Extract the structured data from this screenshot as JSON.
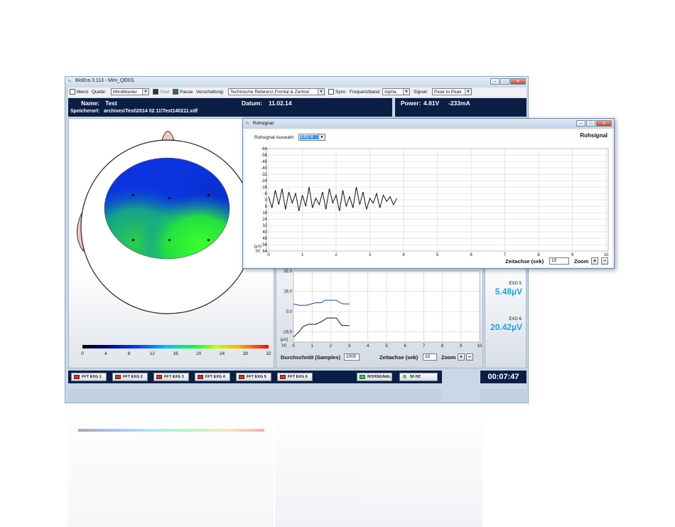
{
  "main_window": {
    "title": "BioEra 3.113 - Mini_QEEG",
    "toolbar": {
      "menu": "Menü",
      "quelle_label": "Quelle:",
      "quelle_value": "MindMaster",
      "start": "Start",
      "pause": "Pause",
      "verschaltung_label": "Verschaltung:",
      "verschaltung_value": "Technische Referenz,Frontal & Zentral",
      "sync": "Sync",
      "frequenzband_label": "Frequenzband:",
      "frequenzband_value": "Alpha",
      "signal_label": "Signal:",
      "signal_value": "Peak to Peak"
    },
    "info": {
      "name_label": "Name:",
      "name_value": "Test",
      "datum_label": "Datum:",
      "datum_value": "11.02.14",
      "speicherort_label": "Speicherort:",
      "speicherort_value": "archives\\Test\\2014 02 11\\Test140211.xdf",
      "power_label": "Power:",
      "power_voltage": "4.81V",
      "power_current": "-233mA"
    },
    "colorbar_ticks": [
      "0",
      "4",
      "8",
      "12",
      "16",
      "20",
      "24",
      "28",
      "32"
    ],
    "mid_chart": {
      "y_ticks": [
        "32.0",
        "16.0",
        "0.0",
        "-16.0"
      ],
      "y_unit": "[µV]",
      "x_unit": "[s]",
      "x_ticks": [
        "0",
        "1",
        "2",
        "3",
        "4",
        "5",
        "6",
        "7",
        "8",
        "9",
        "10"
      ],
      "durchschnitt_label": "Durchschnitt (Samples)",
      "durchschnitt_value": "2000",
      "zeitachse_label": "Zeitachse (sek)",
      "zeitachse_value": "10",
      "zoom_label": "Zoom"
    },
    "readouts": [
      {
        "label": "EXG 5",
        "value": "5.48µV"
      },
      {
        "label": "EXG 6",
        "value": "20.42µV"
      }
    ],
    "buttons": [
      "FFT EXG 1",
      "FFT EXG 2",
      "FFT EXG 3",
      "FFT EXG 4",
      "FFT EXG 5",
      "FFT EXG 6"
    ],
    "rohsignal_button": "ROHSIGNAL",
    "hz_button": "50 HZ",
    "timer": "00:07:47"
  },
  "rohsignal_window": {
    "title": "Rohsignal",
    "heading": "Rohsignal",
    "auswahl_label": "Rohsignal Auswahl",
    "auswahl_value": "EXG 6",
    "y_unit": "[µV]",
    "x_unit": "[s]",
    "zeitachse_label": "Zeitachse (sek)",
    "zeitachse_value": "10",
    "zoom_label": "Zoom"
  },
  "chart_data": [
    {
      "type": "line",
      "title": "Rohsignal",
      "xlabel": "[s]",
      "ylabel": "[µV]",
      "xlim": [
        0,
        10
      ],
      "ylim": [
        -64,
        64
      ],
      "y_inverted": true,
      "x_ticks": [
        0,
        1,
        2,
        3,
        4,
        5,
        6,
        7,
        8,
        9,
        10
      ],
      "y_ticks": [
        -64,
        -56,
        -48,
        -40,
        -32,
        -24,
        -16,
        -8,
        0,
        8,
        16,
        24,
        32,
        40,
        48,
        56,
        64
      ],
      "grid": true,
      "series": [
        {
          "color": "#111111",
          "x": [
            0.0,
            0.1,
            0.2,
            0.3,
            0.4,
            0.5,
            0.6,
            0.7,
            0.8,
            0.9,
            1.0,
            1.1,
            1.2,
            1.3,
            1.4,
            1.5,
            1.6,
            1.7,
            1.8,
            1.9,
            2.0,
            2.1,
            2.2,
            2.3,
            2.4,
            2.5,
            2.6,
            2.7,
            2.8,
            2.9,
            3.0,
            3.1,
            3.2,
            3.3,
            3.4,
            3.5,
            3.6,
            3.7,
            3.8
          ],
          "y": [
            -4,
            10,
            -12,
            6,
            -14,
            12,
            -10,
            4,
            -8,
            14,
            -6,
            8,
            -16,
            10,
            -2,
            6,
            -10,
            12,
            -14,
            4,
            -6,
            14,
            -12,
            8,
            -4,
            10,
            -16,
            6,
            -10,
            12,
            -2,
            4,
            -8,
            10,
            -6,
            2,
            -4,
            6,
            -2
          ]
        }
      ]
    },
    {
      "type": "line",
      "xlabel": "[s]",
      "ylabel": "[µV]",
      "xlim": [
        0,
        10
      ],
      "ylim": [
        -24,
        32
      ],
      "x_ticks": [
        0,
        1,
        2,
        3,
        4,
        5,
        6,
        7,
        8,
        9,
        10
      ],
      "y_ticks": [
        32,
        16,
        0,
        -16
      ],
      "grid": true,
      "series": [
        {
          "color": "#1f3fbf",
          "x": [
            0,
            0.3,
            0.7,
            1.2,
            1.5,
            1.7,
            2.0,
            2.3,
            2.5,
            2.7,
            3.0
          ],
          "y": [
            6,
            5,
            5,
            7,
            7,
            9,
            9,
            9,
            7,
            6,
            6
          ]
        },
        {
          "color": "#111111",
          "x": [
            0,
            0.3,
            0.5,
            0.8,
            1.2,
            1.5,
            1.8,
            2.0,
            2.3,
            2.6,
            3.0
          ],
          "y": [
            -20,
            -16,
            -12,
            -10,
            -10,
            -8,
            -5,
            -5,
            -5,
            -11,
            -11
          ]
        }
      ]
    }
  ]
}
